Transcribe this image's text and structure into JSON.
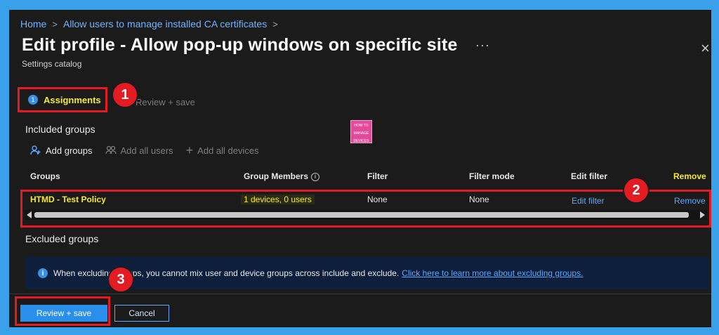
{
  "breadcrumb": {
    "home": "Home",
    "current": "Allow users to manage installed CA certificates",
    "separator": ">"
  },
  "header": {
    "title": "Edit profile - Allow pop-up windows on specific site",
    "subtitle": "Settings catalog",
    "more": "···",
    "close": "×"
  },
  "steps": {
    "assignments_number": "1",
    "assignments_label": "Assignments",
    "review_label": "Review + save"
  },
  "callouts": [
    "1",
    "2",
    "3"
  ],
  "included": {
    "label": "Included groups",
    "toolbar": {
      "add_groups": "Add groups",
      "add_all_users": "Add all users",
      "add_all_devices": "Add all devices"
    }
  },
  "logo": {
    "line1": "HOW TO",
    "line2": "MANAGE",
    "line3": "DEVICES"
  },
  "table": {
    "headers": {
      "groups": "Groups",
      "members": "Group Members",
      "filter": "Filter",
      "filter_mode": "Filter mode",
      "edit_filter": "Edit filter",
      "remove": "Remove"
    },
    "rows": [
      {
        "group": "HTMD - Test Policy",
        "members": "1 devices, 0 users",
        "filter": "None",
        "filter_mode": "None",
        "edit_filter": "Edit filter",
        "remove": "Remove"
      }
    ]
  },
  "excluded": {
    "label": "Excluded groups",
    "info_text": "When excluding groups, you cannot mix user and device groups across include and exclude.",
    "info_link": "Click here to learn more about excluding groups."
  },
  "footer": {
    "review_save": "Review + save",
    "cancel": "Cancel"
  },
  "colors": {
    "background": "#3aa0ea",
    "panel": "#1b1b1b",
    "highlight": "#e31b23",
    "yellow_text": "#f7ea2e",
    "link": "#5aa9ff",
    "primary_button": "#2a8fea"
  }
}
